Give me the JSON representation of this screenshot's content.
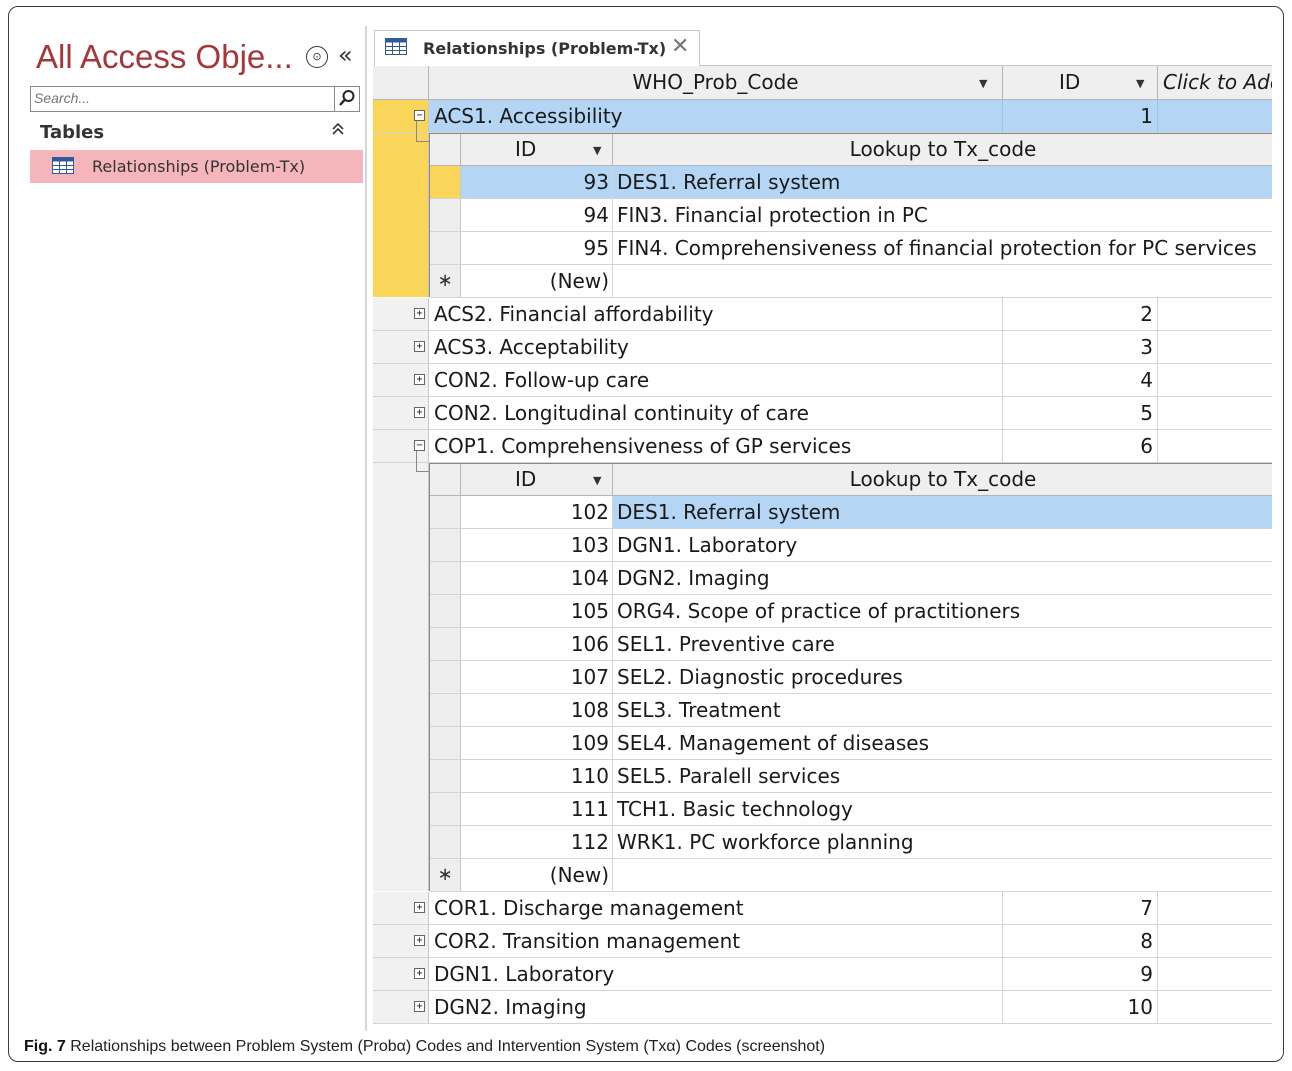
{
  "nav": {
    "title": "All Access Obje...",
    "menu_glyph": "⊙",
    "collapse_glyph": "«",
    "search_placeholder": "Search...",
    "group_label": "Tables",
    "group_chevron": "≪",
    "items": [
      {
        "label": "Relationships (Problem-Tx)",
        "icon": "table-icon"
      }
    ]
  },
  "tab": {
    "label": "Relationships (Problem-Tx)",
    "close_glyph": "✕",
    "icon": "table-icon"
  },
  "columns": {
    "code": "WHO_Prob_Code",
    "id": "ID",
    "add": "Click to Add"
  },
  "subcolumns": {
    "id": "ID",
    "lookup": "Lookup to Tx_code"
  },
  "rows": [
    {
      "code": "ACS1. Accessibility",
      "id": "1",
      "expanded": true,
      "sub": [
        {
          "id": "93",
          "lookup": "DES1. Referral system"
        },
        {
          "id": "94",
          "lookup": "FIN3. Financial protection in PC"
        },
        {
          "id": "95",
          "lookup": "FIN4. Comprehensiveness of financial protection for PC services"
        },
        {
          "id": "(New)",
          "lookup": ""
        }
      ]
    },
    {
      "code": "ACS2. Financial affordability",
      "id": "2",
      "expanded": false
    },
    {
      "code": "ACS3. Acceptability",
      "id": "3",
      "expanded": false
    },
    {
      "code": "CON2. Follow-up care",
      "id": "4",
      "expanded": false
    },
    {
      "code": "CON2. Longitudinal continuity of care",
      "id": "5",
      "expanded": false
    },
    {
      "code": "COP1. Comprehensiveness of GP services",
      "id": "6",
      "expanded": true,
      "sub": [
        {
          "id": "102",
          "lookup": "DES1. Referral system"
        },
        {
          "id": "103",
          "lookup": "DGN1. Laboratory"
        },
        {
          "id": "104",
          "lookup": "DGN2. Imaging"
        },
        {
          "id": "105",
          "lookup": "ORG4. Scope of practice of practitioners"
        },
        {
          "id": "106",
          "lookup": "SEL1. Preventive care"
        },
        {
          "id": "107",
          "lookup": "SEL2. Diagnostic procedures"
        },
        {
          "id": "108",
          "lookup": "SEL3. Treatment"
        },
        {
          "id": "109",
          "lookup": "SEL4. Management of diseases"
        },
        {
          "id": "110",
          "lookup": "SEL5. Paralell services"
        },
        {
          "id": "111",
          "lookup": "TCH1. Basic technology"
        },
        {
          "id": "112",
          "lookup": "WRK1. PC workforce planning"
        },
        {
          "id": "(New)",
          "lookup": ""
        }
      ]
    },
    {
      "code": "COR1. Discharge management",
      "id": "7",
      "expanded": false
    },
    {
      "code": "COR2. Transition management",
      "id": "8",
      "expanded": false
    },
    {
      "code": "DGN1. Laboratory",
      "id": "9",
      "expanded": false
    },
    {
      "code": "DGN2. Imaging",
      "id": "10",
      "expanded": false
    }
  ],
  "new_record_glyph": "∗",
  "expand_glyph": "+",
  "collapse_row_glyph": "−",
  "caption": {
    "label": "Fig. 7",
    "text": "Relationships between Problem System (Probα) Codes and Intervention System (Txα) Codes (screenshot)"
  },
  "colors": {
    "title_red": "#a4373a",
    "nav_selected": "#f4b6bb",
    "row_highlight": "#b4d5f3",
    "record_selector_current": "#f9d55a"
  }
}
